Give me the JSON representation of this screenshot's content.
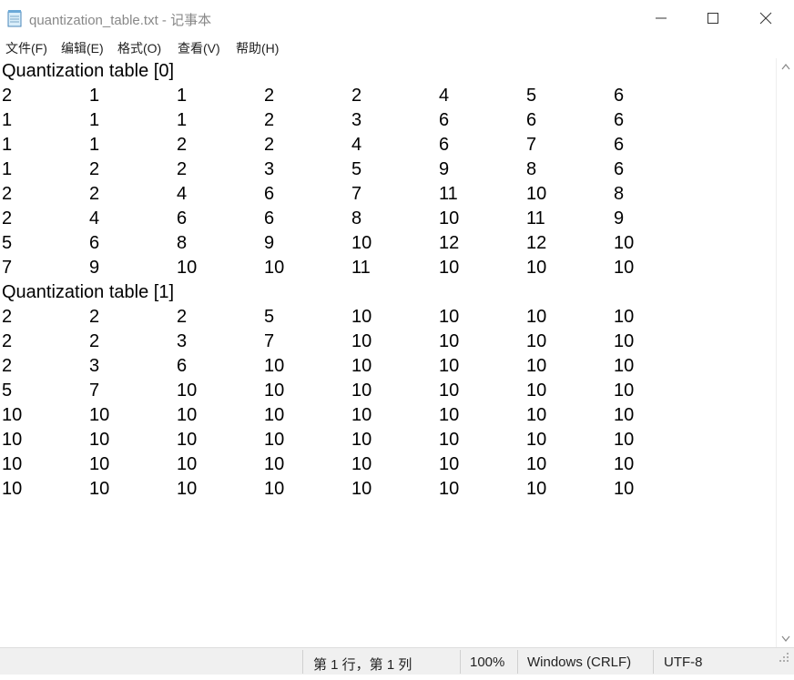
{
  "window": {
    "title": "quantization_table.txt - 记事本"
  },
  "menu": [
    {
      "label": "文件(F)"
    },
    {
      "label": "编辑(E)"
    },
    {
      "label": "格式(O)"
    },
    {
      "label": "查看(V)"
    },
    {
      "label": "帮助(H)"
    }
  ],
  "tables": [
    {
      "heading": "Quantization table [0]",
      "rows": [
        [
          "2",
          "1",
          "1",
          "2",
          "2",
          "4",
          "5",
          "6"
        ],
        [
          "1",
          "1",
          "1",
          "2",
          "3",
          "6",
          "6",
          "6"
        ],
        [
          "1",
          "1",
          "2",
          "2",
          "4",
          "6",
          "7",
          "6"
        ],
        [
          "1",
          "2",
          "2",
          "3",
          "5",
          "9",
          "8",
          "6"
        ],
        [
          "2",
          "2",
          "4",
          "6",
          "7",
          "11",
          "10",
          "8"
        ],
        [
          "2",
          "4",
          "6",
          "6",
          "8",
          "10",
          "11",
          "9"
        ],
        [
          "5",
          "6",
          "8",
          "9",
          "10",
          "12",
          "12",
          "10"
        ],
        [
          "7",
          "9",
          "10",
          "10",
          "11",
          "10",
          "10",
          "10"
        ]
      ]
    },
    {
      "heading": "Quantization table [1]",
      "rows": [
        [
          "2",
          "2",
          "2",
          "5",
          "10",
          "10",
          "10",
          "10"
        ],
        [
          "2",
          "2",
          "3",
          "7",
          "10",
          "10",
          "10",
          "10"
        ],
        [
          "2",
          "3",
          "6",
          "10",
          "10",
          "10",
          "10",
          "10"
        ],
        [
          "5",
          "7",
          "10",
          "10",
          "10",
          "10",
          "10",
          "10"
        ],
        [
          "10",
          "10",
          "10",
          "10",
          "10",
          "10",
          "10",
          "10"
        ],
        [
          "10",
          "10",
          "10",
          "10",
          "10",
          "10",
          "10",
          "10"
        ],
        [
          "10",
          "10",
          "10",
          "10",
          "10",
          "10",
          "10",
          "10"
        ],
        [
          "10",
          "10",
          "10",
          "10",
          "10",
          "10",
          "10",
          "10"
        ]
      ]
    }
  ],
  "status": {
    "position": "第 1 行，第 1 列",
    "zoom": "100%",
    "line_ending": "Windows (CRLF)",
    "encoding": "UTF-8"
  },
  "icons": {
    "app": "notepad-icon",
    "minimize": "minimize-icon",
    "maximize": "maximize-icon",
    "close": "close-icon",
    "scroll_up": "chevron-up-icon",
    "scroll_down": "chevron-down-icon",
    "resize": "resize-grip-icon"
  }
}
